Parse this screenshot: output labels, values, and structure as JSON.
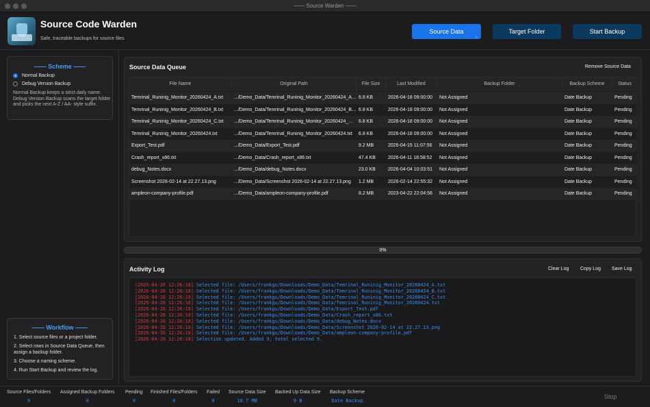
{
  "window": {
    "title": "—— Source Warden ——"
  },
  "header": {
    "title": "Source Code Warden",
    "subtitle": "Safe, traceable backups for source files",
    "buttons": {
      "source_data": "Source Data",
      "target_folder": "Target Folder",
      "start_backup": "Start Backup"
    }
  },
  "scheme": {
    "title": "—— Scheme ——",
    "options": [
      {
        "label": "Normal Backup",
        "selected": true
      },
      {
        "label": "Debug Version Backup",
        "selected": false
      }
    ],
    "description": "Normal Backup keeps a strict daily name. Debug Version Backup scans the target folder and picks the next A-Z / AA- style suffix."
  },
  "workflow": {
    "title": "—— Workflow ——",
    "steps": [
      "1. Select source files or a project folder.",
      "2. Select rows in Source Data Queue, then assign a backup folder.",
      "3. Choose a naming scheme.",
      "4. Run Start Backup and review the log."
    ]
  },
  "queue": {
    "title": "Source Data Queue",
    "remove_label": "Remove Source Data",
    "columns": [
      "File Name",
      "Original Path",
      "File Size",
      "Last Modified",
      "Backup Folder",
      "Backup Scheme",
      "Status"
    ],
    "rows": [
      [
        "Temrinal_Runinig_Monitor_20260424_A.txt",
        ".../Demo_Data/Temrinal_Runinig_Monitor_20260424_A.txt",
        "6.8 KB",
        "2026-04-18 09:00:00",
        "Not Assigned",
        "Date Backup",
        "Pending"
      ],
      [
        "Temrinal_Runinig_Monitor_20260424_B.txt",
        ".../Demo_Data/Temrinal_Runinig_Monitor_20260424_B.txt",
        "6.8 KB",
        "2026-04-18 09:00:00",
        "Not Assigned",
        "Date Backup",
        "Pending"
      ],
      [
        "Temrinal_Runinig_Monitor_20260424_C.txt",
        ".../Demo_Data/Temrinal_Runinig_Monitor_20260424_C.txt",
        "6.8 KB",
        "2026-04-18 09:00:00",
        "Not Assigned",
        "Date Backup",
        "Pending"
      ],
      [
        "Temrinal_Runinig_Monitor_20260424.txt",
        ".../Demo_Data/Temrinal_Runinig_Monitor_20260424.txt",
        "6.8 KB",
        "2026-04-18 09:00:00",
        "Not Assigned",
        "Date Backup",
        "Pending"
      ],
      [
        "Export_Test.pdf",
        ".../Demo_Data/Export_Test.pdf",
        "9.2 MB",
        "2026-04-15 11:07:56",
        "Not Assigned",
        "Date Backup",
        "Pending"
      ],
      [
        "Crash_report_x86.txt",
        ".../Demo_Data/Crash_report_x86.txt",
        "47.4 KB",
        "2026-04-11 18:58:52",
        "Not Assigned",
        "Date Backup",
        "Pending"
      ],
      [
        "debug_Notes.docx",
        ".../Demo_Data/debug_Notes.docx",
        "23.0 KB",
        "2026-04-04 10:03:51",
        "Not Assigned",
        "Date Backup",
        "Pending"
      ],
      [
        "Screenshot 2026-02-14 at 22.27.13.png",
        ".../Demo_Data/Screenshot 2026-02-14 at 22.27.13.png",
        "1.2 MB",
        "2026-02-14 22:55:32",
        "Not Assigned",
        "Date Backup",
        "Pending"
      ],
      [
        "ampleon-company-profile.pdf",
        ".../Demo_Data/ampleon-company-profile.pdf",
        "8.2 MB",
        "2023-04-22 22:04:56",
        "Not Assigned",
        "Date Backup",
        "Pending"
      ]
    ]
  },
  "progress": {
    "value": 0,
    "label": "0%"
  },
  "activity_log": {
    "title": "Activity Log",
    "buttons": {
      "clear": "Clear Log",
      "copy": "Copy Log",
      "save": "Save Log"
    },
    "entries": [
      {
        "ts": "[2026-04-26 12:26:18]",
        "msg": "Selected file: /Users/frankgu/Downloads/Demo_Data/Temrinal_Runinig_Monitor_20260424_A.txt"
      },
      {
        "ts": "[2026-04-26 12:26:18]",
        "msg": "Selected file: /Users/frankgu/Downloads/Demo_Data/Temrinal_Runinig_Monitor_20260424_B.txt"
      },
      {
        "ts": "[2026-04-26 12:26:18]",
        "msg": "Selected file: /Users/frankgu/Downloads/Demo_Data/Temrinal_Runinig_Monitor_20260424_C.txt"
      },
      {
        "ts": "[2026-04-26 12:26:18]",
        "msg": "Selected file: /Users/frankgu/Downloads/Demo_Data/Temrinal_Runinig_Monitor_20260424.txt"
      },
      {
        "ts": "[2026-04-26 12:26:18]",
        "msg": "Selected file: /Users/frankgu/Downloads/Demo_Data/Export_Test.pdf"
      },
      {
        "ts": "[2026-04-26 12:26:18]",
        "msg": "Selected file: /Users/frankgu/Downloads/Demo_Data/Crash_report_x86.txt"
      },
      {
        "ts": "[2026-04-26 12:26:18]",
        "msg": "Selected file: /Users/frankgu/Downloads/Demo_Data/debug_Notes.docx"
      },
      {
        "ts": "[2026-04-26 12:26:18]",
        "msg": "Selected file: /Users/frankgu/Downloads/Demo_Data/Screenshot 2026-02-14 at 22.27.13.png"
      },
      {
        "ts": "[2026-04-26 12:26:18]",
        "msg": "Selected file: /Users/frankgu/Downloads/Demo_Data/ampleon-company-profile.pdf"
      },
      {
        "ts": "[2026-04-26 12:26:18]",
        "msg": "Selection updated. Added 9; total selected 9."
      }
    ]
  },
  "status": {
    "items": [
      {
        "label": "Source Files/Folders",
        "value": "9"
      },
      {
        "label": "Assigned Backup Folders",
        "value": "0"
      },
      {
        "label": "Pending",
        "value": "9"
      },
      {
        "label": "Finished Files/Folders",
        "value": "0"
      },
      {
        "label": "Failed",
        "value": "0"
      },
      {
        "label": "Source Data Size",
        "value": "18.7 MB"
      },
      {
        "label": "Backed Up Data Size",
        "value": "0 B"
      },
      {
        "label": "Backup Scheme",
        "value": "Date Backup"
      }
    ],
    "stop_label": "Stop"
  },
  "colors": {
    "accent": "#1a73e8",
    "log_timestamp": "#d53b3b",
    "log_message": "#3b8ef0",
    "background": "#1c1c1e"
  }
}
